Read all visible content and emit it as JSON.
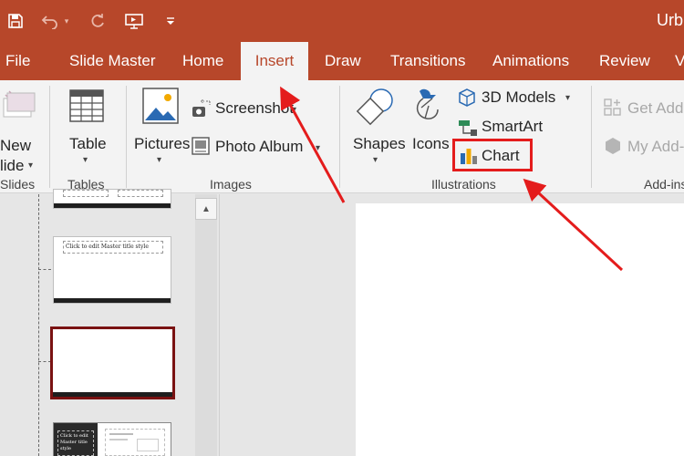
{
  "window": {
    "title": "Urb"
  },
  "quick_access": {
    "icons": [
      "save-icon",
      "undo-icon",
      "redo-icon",
      "present-from-start-icon",
      "customize-qat-icon"
    ]
  },
  "tabs": [
    {
      "label": "File",
      "active": false
    },
    {
      "label": "Slide Master",
      "active": false
    },
    {
      "label": "Home",
      "active": false
    },
    {
      "label": "Insert",
      "active": true
    },
    {
      "label": "Draw",
      "active": false
    },
    {
      "label": "Transitions",
      "active": false
    },
    {
      "label": "Animations",
      "active": false
    },
    {
      "label": "Review",
      "active": false
    },
    {
      "label": "V",
      "active": false
    }
  ],
  "ribbon": {
    "slides": {
      "new_label_1": "New",
      "new_label_2": "lide",
      "group_label": "Slides"
    },
    "tables": {
      "table_label": "Table",
      "group_label": "Tables"
    },
    "images": {
      "pictures_label": "Pictures",
      "screenshot_label": "Screenshot",
      "photo_album_label": "Photo Album",
      "group_label": "Images"
    },
    "illustrations": {
      "shapes_label": "Shapes",
      "icons_label": "Icons",
      "models_label": "3D Models",
      "smartart_label": "SmartArt",
      "chart_label": "Chart",
      "group_label": "Illustrations"
    },
    "addins": {
      "get_addins_label": "Get Add",
      "my_addins_label": "My Add-",
      "group_label": "Add-ins"
    }
  },
  "thumbnails": {
    "layout_title_text": "Click to edit Master title style",
    "master_title_text": "Click to edit Master title style"
  },
  "colors": {
    "accent": "#b7472a",
    "highlight": "#e41c1c",
    "selected_border": "#7a1212"
  }
}
